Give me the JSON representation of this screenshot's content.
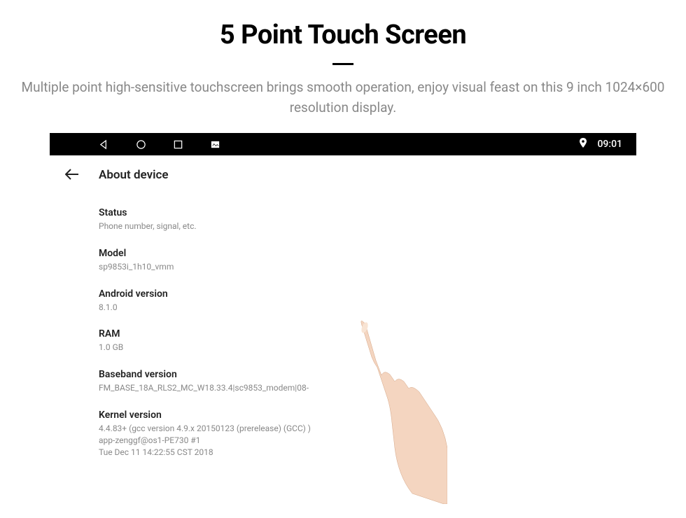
{
  "page": {
    "title": "5 Point Touch Screen",
    "subtitle": "Multiple point high-sensitive touchscreen brings smooth operation, enjoy visual feast on this 9 inch 1024×600 resolution display."
  },
  "statusBar": {
    "time": "09:01"
  },
  "header": {
    "title": "About device"
  },
  "settings": {
    "items": [
      {
        "title": "Status",
        "subtitle": "Phone number, signal, etc."
      },
      {
        "title": "Model",
        "subtitle": "sp9853i_1h10_vmm"
      },
      {
        "title": "Android version",
        "subtitle": "8.1.0"
      },
      {
        "title": "RAM",
        "subtitle": "1.0 GB"
      },
      {
        "title": "Baseband version",
        "subtitle": "FM_BASE_18A_RLS2_MC_W18.33.4|sc9853_modem|08-"
      },
      {
        "title": "Kernel version",
        "subtitle": "4.4.83+ (gcc version 4.9.x 20150123 (prerelease) (GCC) )\napp-zenggf@os1-PE730 #1\nTue Dec 11 14:22:55 CST 2018"
      }
    ]
  }
}
